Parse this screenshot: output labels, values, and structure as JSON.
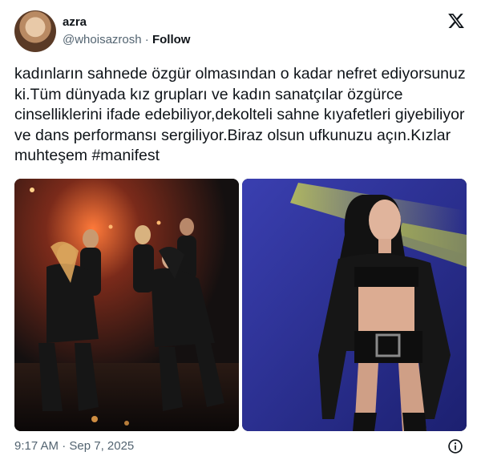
{
  "author": {
    "display_name": "azra",
    "handle": "@whoisazrosh",
    "separator": "·",
    "follow_label": "Follow"
  },
  "tweet": {
    "text": "kadınların sahnede özgür olmasından o kadar nefret ediyorsunuz ki.Tüm dünyada kız grupları ve kadın sanatçılar özgürce cinselliklerini ifade edebiliyor,dekolteli sahne kıyafetleri giyebiliyor ve dans performansı sergiliyor.Biraz olsun ufkunuzu açın.Kızlar muhteşem #manifest",
    "timestamp": "9:17 AM · Sep 7, 2025"
  },
  "icons": {
    "platform_logo": "x-logo-icon",
    "info": "info-icon"
  },
  "colors": {
    "text_primary": "#0f1419",
    "text_secondary": "#536471",
    "photo_right_background": "#2a2f8f",
    "photo_right_light": "#c8d92a"
  }
}
